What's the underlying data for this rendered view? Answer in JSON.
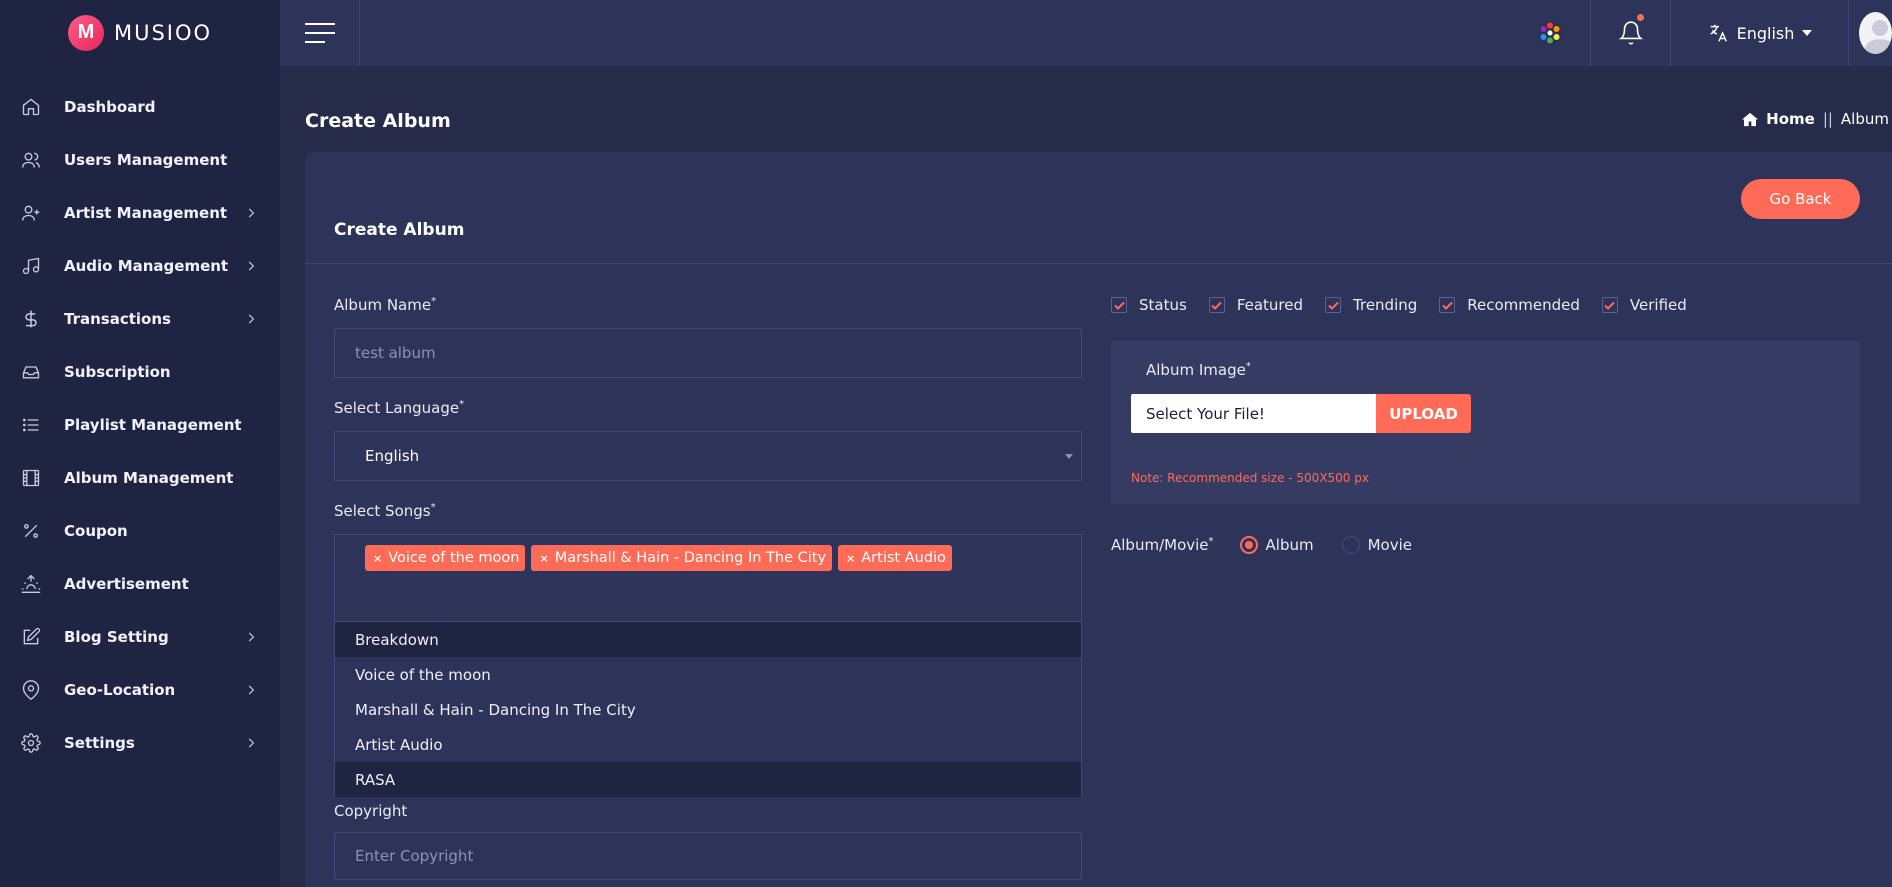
{
  "brand": {
    "name": "MUSIOO",
    "mark": "M"
  },
  "sidebar": {
    "items": [
      {
        "label": "Dashboard",
        "icon": "home-icon",
        "has_children": false
      },
      {
        "label": "Users Management",
        "icon": "users-icon",
        "has_children": false
      },
      {
        "label": "Artist Management",
        "icon": "user-plus-icon",
        "has_children": true
      },
      {
        "label": "Audio Management",
        "icon": "music-note-icon",
        "has_children": true
      },
      {
        "label": "Transactions",
        "icon": "dollar-icon",
        "has_children": true
      },
      {
        "label": "Subscription",
        "icon": "inbox-icon",
        "has_children": false
      },
      {
        "label": "Playlist Management",
        "icon": "list-icon",
        "has_children": false
      },
      {
        "label": "Album Management",
        "icon": "film-icon",
        "has_children": false
      },
      {
        "label": "Coupon",
        "icon": "percent-icon",
        "has_children": false
      },
      {
        "label": "Advertisement",
        "icon": "sunrise-icon",
        "has_children": false
      },
      {
        "label": "Blog Setting",
        "icon": "edit-icon",
        "has_children": true
      },
      {
        "label": "Geo-Location",
        "icon": "map-pin-icon",
        "has_children": true
      },
      {
        "label": "Settings",
        "icon": "gear-icon",
        "has_children": true
      }
    ]
  },
  "topbar": {
    "language": "English"
  },
  "page": {
    "title": "Create Album",
    "breadcrumb": {
      "home": "Home",
      "separator": "||",
      "current": "Album"
    }
  },
  "card": {
    "title": "Create Album",
    "go_back": "Go Back",
    "album_name": {
      "label": "Album Name",
      "required": "*",
      "placeholder": "test album"
    },
    "language": {
      "label": "Select Language",
      "required": "*",
      "value": "English"
    },
    "songs": {
      "label": "Select Songs",
      "required": "*",
      "selected": [
        "Voice of the moon",
        "Marshall & Hain - Dancing In The City",
        "Artist Audio"
      ],
      "chip_remove": "×",
      "options": [
        "Breakdown",
        "Voice of the moon",
        "Marshall & Hain - Dancing In The City",
        "Artist Audio",
        "RASA"
      ]
    },
    "copyright": {
      "label": "Copyright",
      "placeholder": "Enter Copyright"
    },
    "checkboxes": [
      "Status",
      "Featured",
      "Trending",
      "Recommended",
      "Verified"
    ],
    "image": {
      "label": "Album Image",
      "required": "*",
      "file_text": "Select Your File!",
      "upload": "UPLOAD",
      "note": "Note: Recommended size - 500X500 px"
    },
    "album_movie": {
      "label": "Album/Movie",
      "required": "*",
      "options": [
        "Album",
        "Movie"
      ],
      "selected": "Album"
    }
  },
  "colors": {
    "accent": "#ff6b57",
    "sidebar": "#1f2442",
    "card": "#2e3459",
    "background": "#262b4a"
  }
}
